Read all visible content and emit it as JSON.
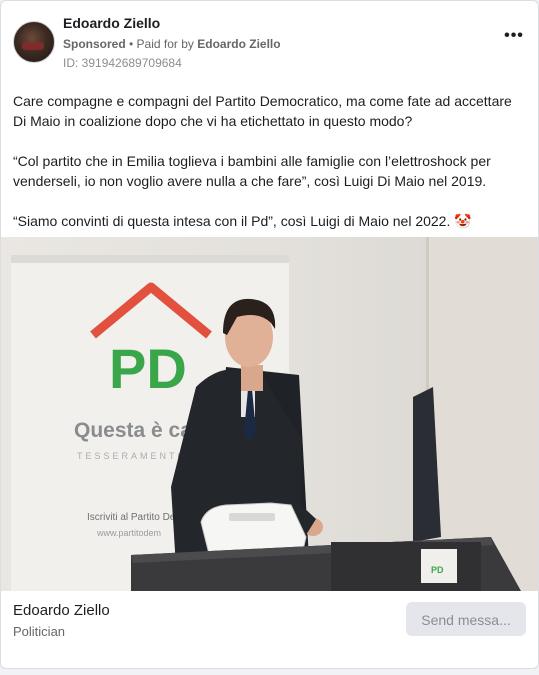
{
  "post": {
    "author": "Edoardo Ziello",
    "sponsored": "Sponsored",
    "dot": " • ",
    "paid_for_prefix": "Paid for by ",
    "paid_for_name": "Edoardo Ziello",
    "id_line": "ID: 391942689709684",
    "more_label": "•••",
    "body": [
      "Care compagne e compagni del Partito Democratico, ma come fate ad accettare Di Maio in coalizione dopo che vi ha etichettato in questo modo?",
      "“Col partito che in Emilia toglieva i bambini alle famiglie con l’elettroshock per venderseli, io non voglio avere nulla a che fare”, così Luigi Di Maio nel 2019.",
      "“Siamo convinti di questa intesa con il Pd”, così Luigi di Maio nel 2022. 🤡"
    ]
  },
  "photo": {
    "logo_letters": "PD",
    "banner_slogan": "Questa è casa",
    "banner_sub": "TESSERAMENTO",
    "banner_small": "Iscriviti al Partito Dem",
    "banner_url": "www.partitodem",
    "desk_tag": "PD",
    "colors": {
      "green": "#3aa64a",
      "red": "#e53a2e",
      "roof": "#e2503e",
      "suit": "#1f2227"
    }
  },
  "footer": {
    "page_name": "Edoardo Ziello",
    "page_category": "Politician",
    "send_button": "Send messa..."
  }
}
